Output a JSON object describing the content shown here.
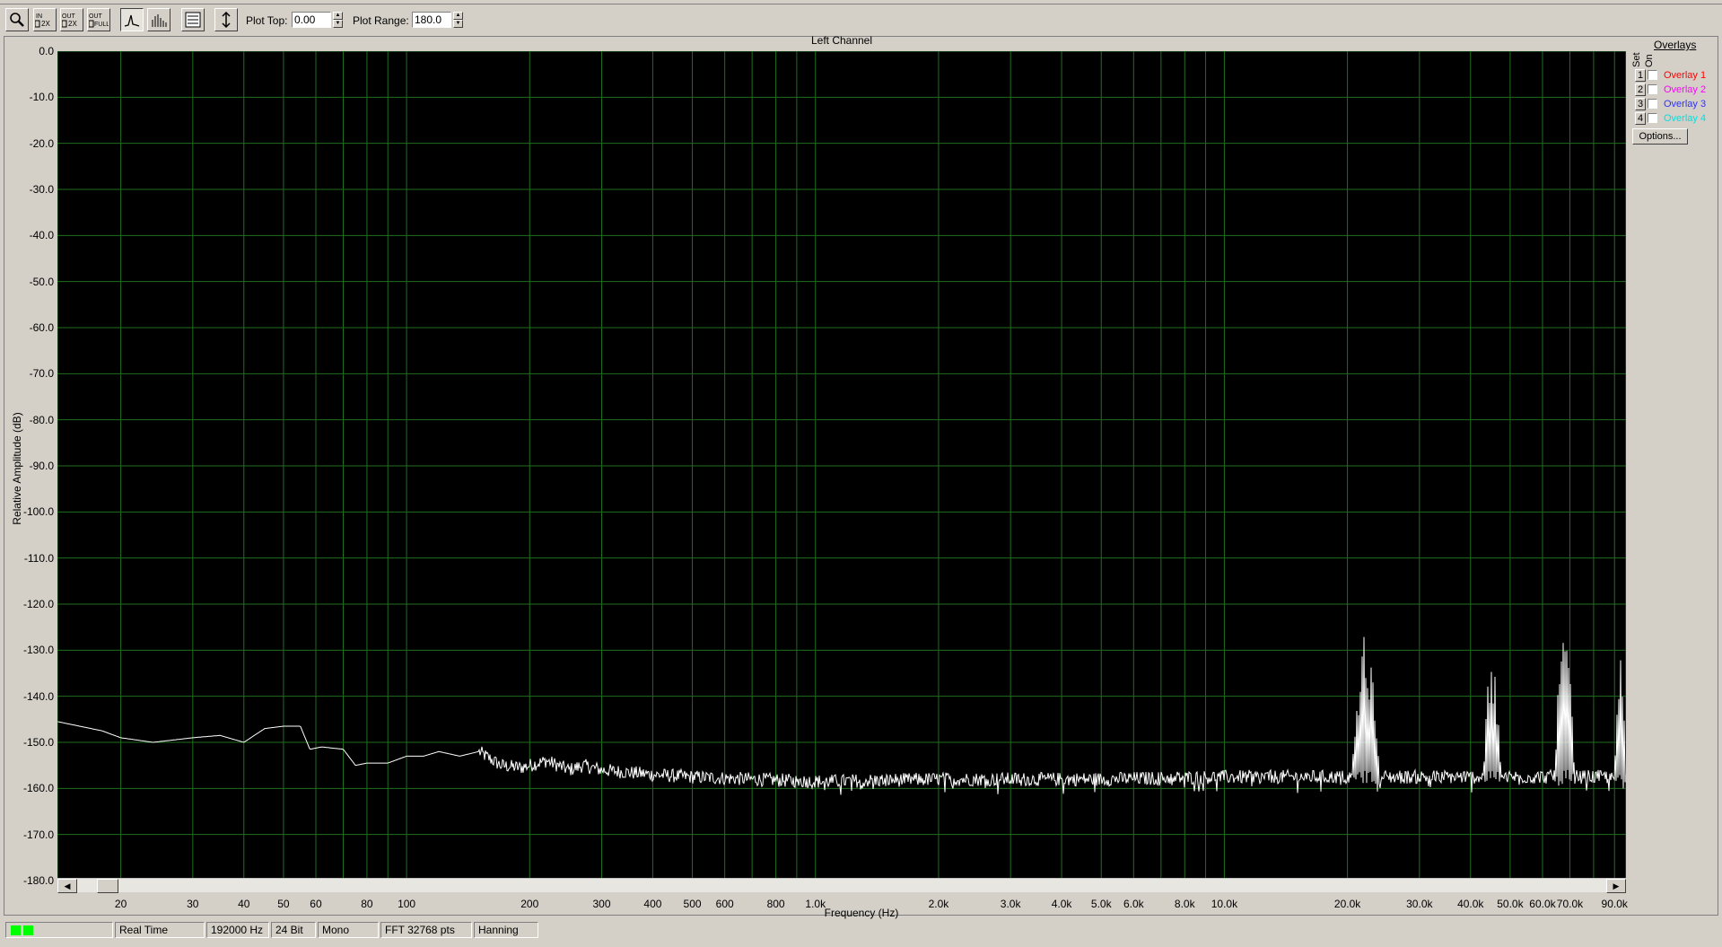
{
  "toolbar": {
    "plot_top_label": "Plot Top:",
    "plot_top_value": "0.00",
    "plot_range_label": "Plot Range:",
    "plot_range_value": "180.0",
    "buttons": [
      "zoom",
      "in 2x",
      "out 2x",
      "out full",
      "line spectrum",
      "bar spectrum",
      "settings",
      "autoscale"
    ]
  },
  "chart_data": {
    "type": "line",
    "title": "Left Channel",
    "xlabel": "Frequency (Hz)",
    "ylabel": "Relative Amplitude (dB)",
    "x_scale": "log",
    "xlim": [
      14,
      96000
    ],
    "ylim": [
      -180,
      0
    ],
    "grid": true,
    "yticks": [
      "0.0",
      "-10.0",
      "-20.0",
      "-30.0",
      "-40.0",
      "-50.0",
      "-60.0",
      "-70.0",
      "-80.0",
      "-90.0",
      "-100.0",
      "-110.0",
      "-120.0",
      "-130.0",
      "-140.0",
      "-150.0",
      "-160.0",
      "-170.0",
      "-180.0"
    ],
    "xticks": [
      {
        "v": 20,
        "label": "20"
      },
      {
        "v": 30,
        "label": "30"
      },
      {
        "v": 40,
        "label": "40"
      },
      {
        "v": 50,
        "label": "50"
      },
      {
        "v": 60,
        "label": "60"
      },
      {
        "v": 80,
        "label": "80"
      },
      {
        "v": 100,
        "label": "100"
      },
      {
        "v": 200,
        "label": "200"
      },
      {
        "v": 300,
        "label": "300"
      },
      {
        "v": 400,
        "label": "400"
      },
      {
        "v": 500,
        "label": "500"
      },
      {
        "v": 600,
        "label": "600"
      },
      {
        "v": 800,
        "label": "800"
      },
      {
        "v": 1000,
        "label": "1.0k"
      },
      {
        "v": 2000,
        "label": "2.0k"
      },
      {
        "v": 3000,
        "label": "3.0k"
      },
      {
        "v": 4000,
        "label": "4.0k"
      },
      {
        "v": 5000,
        "label": "5.0k"
      },
      {
        "v": 6000,
        "label": "6.0k"
      },
      {
        "v": 8000,
        "label": "8.0k"
      },
      {
        "v": 10000,
        "label": "10.0k"
      },
      {
        "v": 20000,
        "label": "20.0k"
      },
      {
        "v": 30000,
        "label": "30.0k"
      },
      {
        "v": 40000,
        "label": "40.0k"
      },
      {
        "v": 50000,
        "label": "50.0k"
      },
      {
        "v": 60000,
        "label": "60.0k"
      },
      {
        "v": 70000,
        "label": "70.0k"
      },
      {
        "v": 90000,
        "label": "90.0k"
      }
    ],
    "series": [
      {
        "color": "#ffffff",
        "x": [
          14,
          18,
          20,
          24,
          30,
          35,
          40,
          45,
          50,
          55,
          58,
          62,
          70,
          75,
          80,
          90,
          100,
          110,
          120,
          135,
          150,
          170,
          190,
          200,
          220,
          250,
          270,
          300,
          400,
          500,
          700,
          1000,
          2000,
          5000,
          10000,
          20000
        ],
        "y": [
          -145.5,
          -147.5,
          -149,
          -150,
          -149,
          -148.5,
          -150,
          -147,
          -146.5,
          -146.5,
          -151.5,
          -151,
          -151.5,
          -155,
          -154.5,
          -154.5,
          -153,
          -153,
          -152,
          -153,
          -152,
          -155,
          -155.5,
          -155,
          -154,
          -156,
          -155,
          -156,
          -157,
          -157.5,
          -158,
          -158.5,
          -158,
          -158,
          -157.5,
          -157.5
        ],
        "noise_db": 1.5,
        "peaks": [
          {
            "f_lo": 20500,
            "f_hi": 24000,
            "top": -126
          },
          {
            "f_lo": 43000,
            "f_hi": 47500,
            "top": -130
          },
          {
            "f_lo": 64000,
            "f_hi": 72000,
            "top": -125
          },
          {
            "f_lo": 90000,
            "f_hi": 96000,
            "top": -131
          }
        ]
      }
    ]
  },
  "overlays": {
    "title": "Overlays",
    "set_label": "Set",
    "on_label": "On",
    "items": [
      {
        "num": "1",
        "name": "Overlay 1",
        "color": "#ff0000"
      },
      {
        "num": "2",
        "name": "Overlay 2",
        "color": "#ff00ff"
      },
      {
        "num": "3",
        "name": "Overlay 3",
        "color": "#3030ff"
      },
      {
        "num": "4",
        "name": "Overlay 4",
        "color": "#00e0e0"
      }
    ],
    "options_label": "Options..."
  },
  "status": {
    "mode": "Real Time",
    "rate": "192000 Hz",
    "bits": "24 Bit",
    "channels": "Mono",
    "fft": "FFT 32768 pts",
    "window": "Hanning"
  },
  "colors": {
    "plot_bg": "#000000",
    "grid": "#1f6e1f",
    "trace": "#ffffff",
    "led": "#00ff00"
  }
}
